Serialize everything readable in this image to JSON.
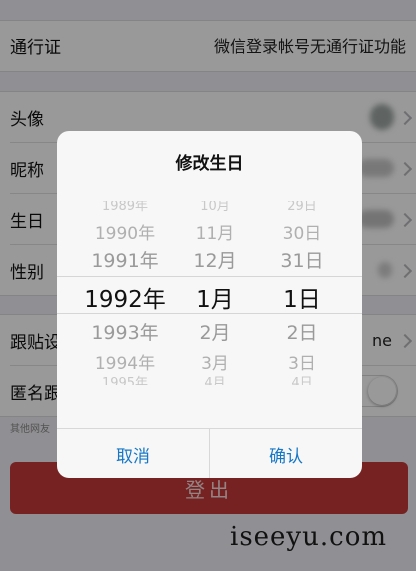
{
  "rows": {
    "pass": {
      "label": "通行证",
      "value": "微信登录帐号无通行证功能"
    },
    "avatar": {
      "label": "头像"
    },
    "nickname": {
      "label": "昵称"
    },
    "birthday": {
      "label": "生日"
    },
    "gender": {
      "label": "性别"
    },
    "follow": {
      "label": "跟贴设",
      "value": "ne"
    },
    "anonymous": {
      "label": "匿名跟"
    }
  },
  "hint": "其他网友",
  "logout": "登出",
  "watermark": "iseeyu.com",
  "dialog": {
    "title": "修改生日",
    "years": [
      "1989年",
      "1990年",
      "1991年",
      "1992年",
      "1993年",
      "1994年",
      "1995年"
    ],
    "months": [
      "10月",
      "11月",
      "12月",
      "1月",
      "2月",
      "3月",
      "4月"
    ],
    "days": [
      "29日",
      "30日",
      "31日",
      "1日",
      "2日",
      "3日",
      "4日"
    ],
    "cancel": "取消",
    "confirm": "确认"
  },
  "colors": {
    "accent": "#1677c7",
    "logout": "#c53a3a"
  }
}
